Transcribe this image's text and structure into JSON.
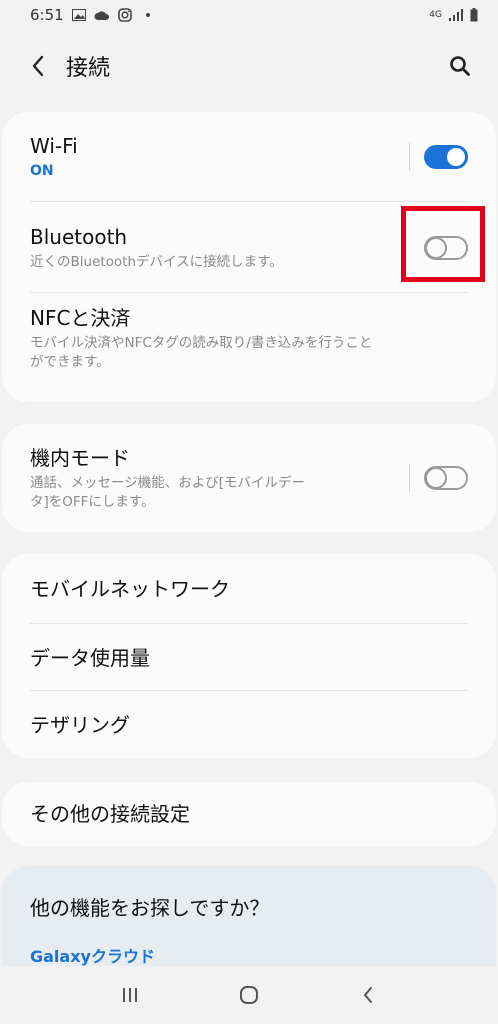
{
  "status_bar": {
    "time": "6:51",
    "network": "4G"
  },
  "app_bar": {
    "title": "接続"
  },
  "connections": {
    "wifi": {
      "title": "Wi-Fi",
      "status": "ON",
      "toggle_on": true
    },
    "bluetooth": {
      "title": "Bluetooth",
      "subtitle": "近くのBluetoothデバイスに接続します。",
      "toggle_on": false
    },
    "nfc": {
      "title": "NFCと決済",
      "subtitle_line1": "モバイル決済やNFCタグの読み取り/書き込みを行うこと",
      "subtitle_line2": "ができます。"
    }
  },
  "airplane": {
    "title": "機内モード",
    "subtitle_line1": "通話、メッセージ機能、および[モバイルデー",
    "subtitle_line2": "タ]をOFFにします。",
    "toggle_on": false
  },
  "network": {
    "items": [
      "モバイルネットワーク",
      "データ使用量",
      "テザリング"
    ]
  },
  "other": {
    "title": "その他の接続設定"
  },
  "promo": {
    "title": "他の機能をお探しですか？",
    "link": "Galaxyクラウド"
  },
  "colors": {
    "accent": "#1a73d9",
    "highlight": "#e5001c",
    "background": "#f2f2f2",
    "card": "#fbfbfb"
  }
}
